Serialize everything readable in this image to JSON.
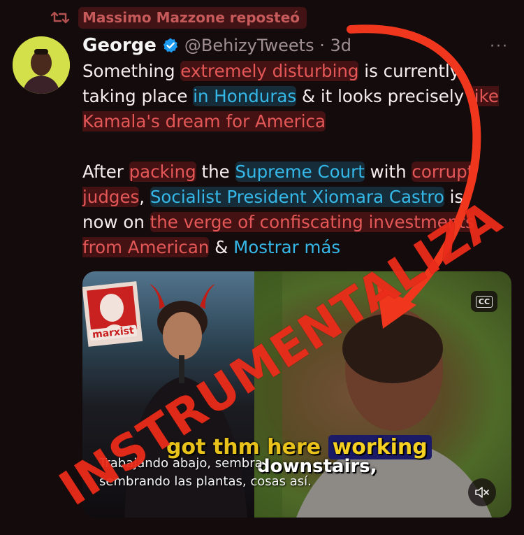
{
  "repost": {
    "text": "Massimo Mazzone reposteó",
    "icon": "repost-icon"
  },
  "tweet": {
    "author_name": "George",
    "verified_icon": "verified-badge-icon",
    "handle": "@BehizyTweets",
    "separator": " · ",
    "time": "3d",
    "more": "···",
    "paragraph1": {
      "p1": "Something ",
      "p2": "extremely disturbing",
      "p3": " is currently taking place ",
      "p4": "in Honduras",
      "p5": " & it looks precisely ",
      "p6": "like Kamala's dream for America"
    },
    "paragraph2": {
      "p1": "After ",
      "p2": "packing",
      "p3": " the ",
      "p4": "Supreme Court",
      "p5": " with ",
      "p6": "corrupt judges",
      "p7": ", ",
      "p8": "Socialist President Xiomara Castro",
      "p9": " is now on ",
      "p10": "the verge of confiscating investments from American",
      "p11": " & ",
      "show_more": "Mostrar más"
    }
  },
  "media": {
    "stamp_label": "marxist",
    "cc_label": "CC",
    "mute_icon": "volume-muted-icon",
    "caption_line1_a": "got th",
    "caption_line1_b": "m here ",
    "caption_highlight": "working",
    "caption_line2": "downstairs,",
    "subtitle_line1": "Trabajando abajo, sembra",
    "subtitle_line2": "sembrando las plantas, cosas así."
  },
  "annotation": {
    "stamp_text": "INSTRUMENTALIZA"
  },
  "colors": {
    "background": "#140b0d",
    "accent_red": "#e45757",
    "link_blue": "#35b7e8",
    "verified_blue": "#1d9bf0",
    "annotation_red": "#ec2c1a"
  }
}
